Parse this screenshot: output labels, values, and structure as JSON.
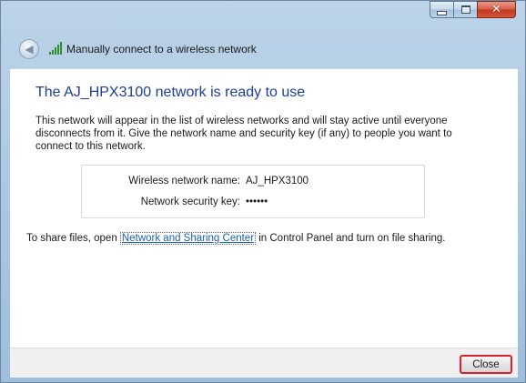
{
  "window": {
    "title": "Manually connect to a wireless network",
    "controls": {
      "minimize": "minimize",
      "maximize": "maximize",
      "close": "close"
    },
    "wifi_icon": "wifi-signal-icon",
    "back_icon": "back-arrow-icon"
  },
  "content": {
    "heading": "The AJ_HPX3100 network is ready to use",
    "description": "This network will appear in the list of wireless networks and will stay active until everyone disconnects from it. Give the network name and security key (if any) to people you want to connect to this network.",
    "info": {
      "name_label": "Wireless network name:",
      "name_value": "AJ_HPX3100",
      "key_label": "Network security key:",
      "key_value": "••••••"
    },
    "share": {
      "prefix": "To share files, open ",
      "link": "Network and Sharing Center",
      "suffix": " in Control Panel and turn on file sharing."
    }
  },
  "footer": {
    "close_label": "Close"
  },
  "colors": {
    "heading": "#1f3c99",
    "link": "#1b5fb4",
    "highlight": "#d8232f"
  }
}
